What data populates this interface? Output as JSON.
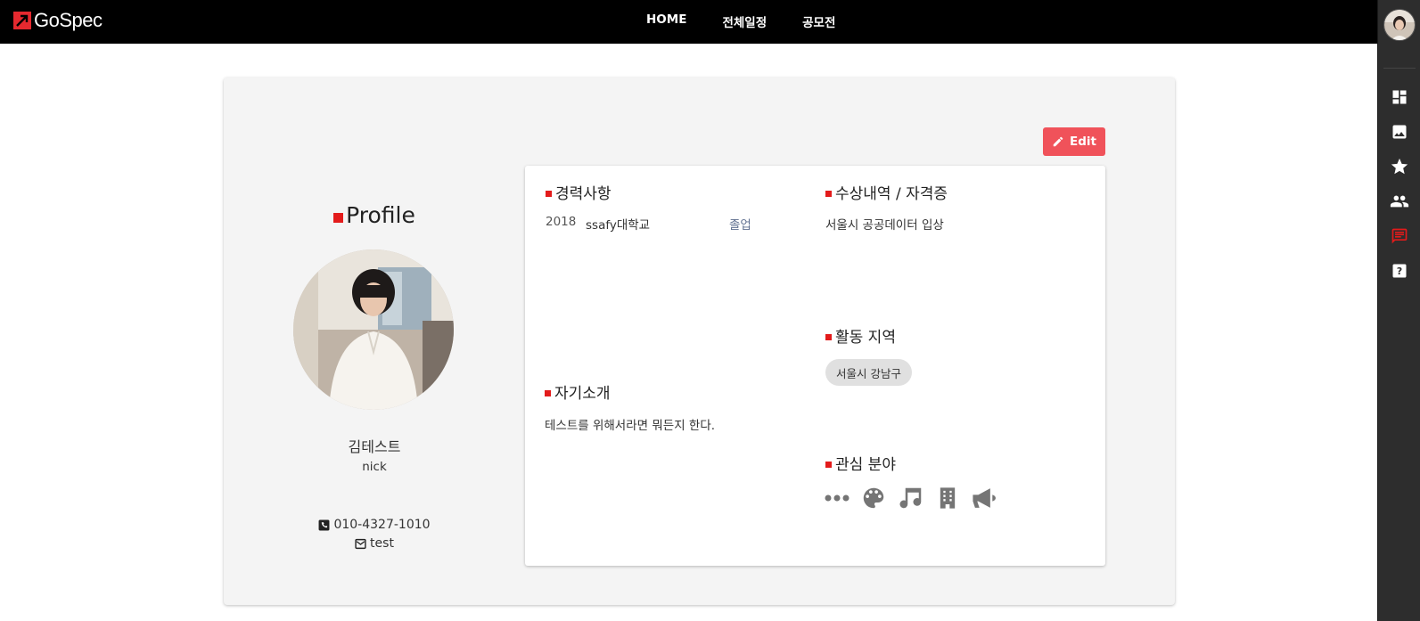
{
  "brand": {
    "name": "GoSpec",
    "accent": "#e5292f"
  },
  "nav": {
    "items": [
      {
        "label": "HOME"
      },
      {
        "label": "전체일정"
      },
      {
        "label": "공모전"
      }
    ]
  },
  "sidebar": {
    "icons": [
      {
        "name": "dashboard-icon",
        "color": "#ffffff"
      },
      {
        "name": "image-icon",
        "color": "#ffffff"
      },
      {
        "name": "star-icon",
        "color": "#ffffff"
      },
      {
        "name": "people-icon",
        "color": "#ffffff"
      },
      {
        "name": "chat-icon",
        "color": "#e31b1b",
        "active": true
      },
      {
        "name": "help-icon",
        "color": "#ffffff"
      }
    ]
  },
  "profile": {
    "title": "Profile",
    "name": "김테스트",
    "nick": "nick",
    "phone": "010-4327-1010",
    "email": "test"
  },
  "edit_button": {
    "label": "Edit"
  },
  "sections": {
    "career": {
      "title": "경력사항",
      "entries": [
        {
          "year": "2018",
          "school": "ssafy대학교",
          "status": "졸업"
        }
      ]
    },
    "awards": {
      "title": "수상내역 / 자격증",
      "items": [
        "서울시 공공데이터 입상"
      ]
    },
    "region": {
      "title": "활동 지역",
      "chips": [
        "서울시 강남구"
      ]
    },
    "intro": {
      "title": "자기소개",
      "text": "테스트를 위해서라면 뭐든지 한다."
    },
    "interests": {
      "title": "관심 분야",
      "icons": [
        "more-icon",
        "palette-icon",
        "music-note-icon",
        "building-icon",
        "megaphone-icon"
      ]
    }
  }
}
